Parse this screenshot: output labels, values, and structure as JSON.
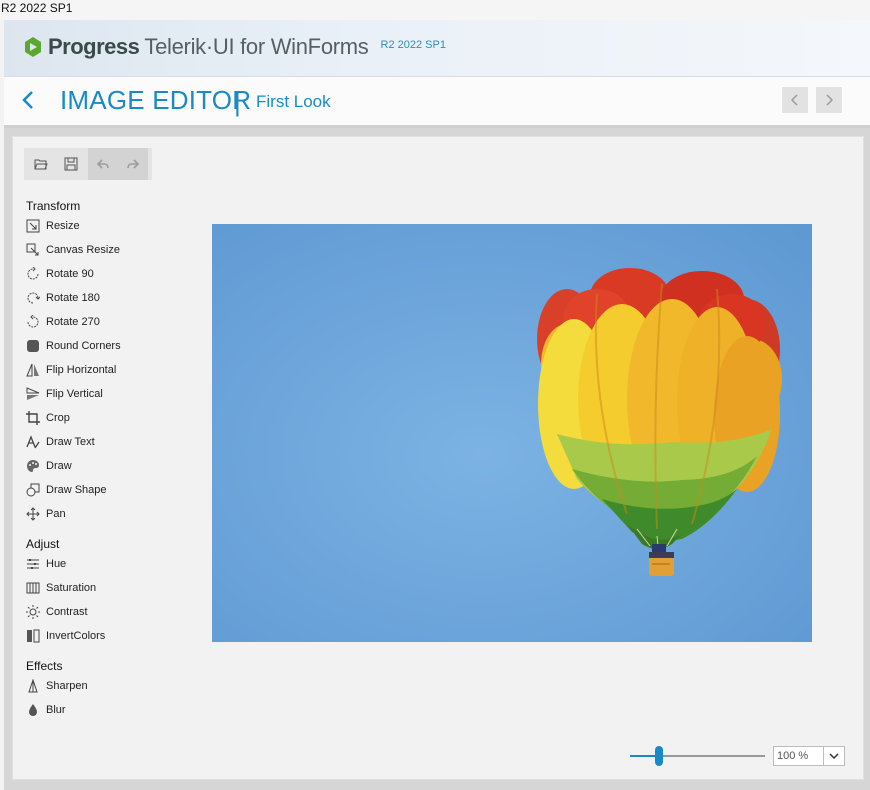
{
  "window": {
    "title": "R2 2022 SP1"
  },
  "brand": {
    "logo_text": "Progress",
    "product": "Telerik·UI for WinForms",
    "version": "R2 2022 SP1"
  },
  "nav": {
    "section_title": "IMAGE EDITOR",
    "separator": "|",
    "subtitle": "First Look",
    "back_icon": "chevron-left-icon",
    "prev_icon": "chevron-left-icon",
    "next_icon": "chevron-right-icon"
  },
  "toolbar": {
    "buttons": [
      {
        "icon": "open-folder-icon",
        "enabled": true
      },
      {
        "icon": "save-icon",
        "enabled": true
      },
      {
        "icon": "undo-icon",
        "enabled": false
      },
      {
        "icon": "redo-icon",
        "enabled": false
      }
    ]
  },
  "tools": {
    "transform": {
      "header": "Transform",
      "items": [
        {
          "label": "Resize",
          "icon": "resize-icon"
        },
        {
          "label": "Canvas Resize",
          "icon": "canvas-resize-icon"
        },
        {
          "label": "Rotate 90",
          "icon": "rotate-90-icon"
        },
        {
          "label": "Rotate 180",
          "icon": "rotate-180-icon"
        },
        {
          "label": "Rotate 270",
          "icon": "rotate-270-icon"
        },
        {
          "label": "Round Corners",
          "icon": "round-corners-icon"
        },
        {
          "label": "Flip Horizontal",
          "icon": "flip-horizontal-icon"
        },
        {
          "label": "Flip Vertical",
          "icon": "flip-vertical-icon"
        },
        {
          "label": "Crop",
          "icon": "crop-icon"
        },
        {
          "label": "Draw Text",
          "icon": "draw-text-icon"
        },
        {
          "label": "Draw",
          "icon": "palette-icon"
        },
        {
          "label": "Draw Shape",
          "icon": "draw-shape-icon"
        },
        {
          "label": "Pan",
          "icon": "pan-icon"
        }
      ]
    },
    "adjust": {
      "header": "Adjust",
      "items": [
        {
          "label": "Hue",
          "icon": "hue-icon"
        },
        {
          "label": "Saturation",
          "icon": "saturation-icon"
        },
        {
          "label": "Contrast",
          "icon": "contrast-icon"
        },
        {
          "label": "InvertColors",
          "icon": "invert-colors-icon"
        }
      ]
    },
    "effects": {
      "header": "Effects",
      "items": [
        {
          "label": "Sharpen",
          "icon": "sharpen-icon"
        },
        {
          "label": "Blur",
          "icon": "blur-icon"
        }
      ]
    }
  },
  "canvas": {
    "image": "hot-air-balloon-photo"
  },
  "zoom": {
    "value": "100 %",
    "slider_fraction": 0.2,
    "dropdown_icon": "chevron-down-icon"
  },
  "colors": {
    "accent": "#1a8ac6",
    "sky": "#6aa4d8"
  }
}
